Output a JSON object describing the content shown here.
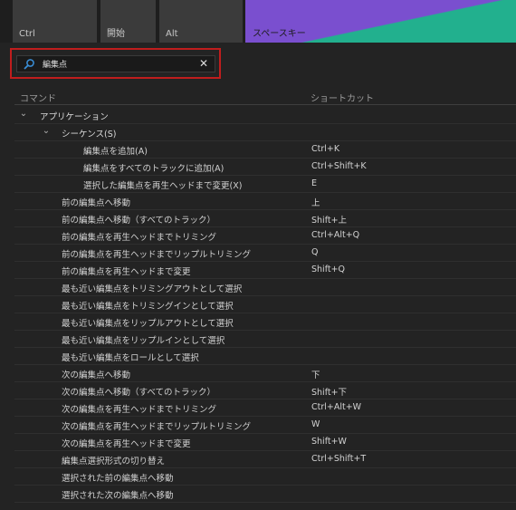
{
  "keyboard": {
    "keys": [
      {
        "label": "Ctrl"
      },
      {
        "label": "開始"
      },
      {
        "label": "Alt"
      },
      {
        "label": "スペースキー"
      }
    ]
  },
  "search": {
    "value": "編集点",
    "placeholder": ""
  },
  "columns": {
    "command": "コマンド",
    "shortcut": "ショートカット"
  },
  "tree": {
    "group": "アプリケーション",
    "subgroup": "シーケンス(S)",
    "items": [
      {
        "cmd": "編集点を追加(A)",
        "sc": "Ctrl+K"
      },
      {
        "cmd": "編集点をすべてのトラックに追加(A)",
        "sc": "Ctrl+Shift+K"
      },
      {
        "cmd": "選択した編集点を再生ヘッドまで変更(X)",
        "sc": "E"
      },
      {
        "cmd": "前の編集点へ移動",
        "sc": "上"
      },
      {
        "cmd": "前の編集点へ移動（すべてのトラック）",
        "sc": "Shift+上"
      },
      {
        "cmd": "前の編集点を再生ヘッドまでトリミング",
        "sc": "Ctrl+Alt+Q"
      },
      {
        "cmd": "前の編集点を再生ヘッドまでリップルトリミング",
        "sc": "Q"
      },
      {
        "cmd": "前の編集点を再生ヘッドまで変更",
        "sc": "Shift+Q"
      },
      {
        "cmd": "最も近い編集点をトリミングアウトとして選択",
        "sc": ""
      },
      {
        "cmd": "最も近い編集点をトリミングインとして選択",
        "sc": ""
      },
      {
        "cmd": "最も近い編集点をリップルアウトとして選択",
        "sc": ""
      },
      {
        "cmd": "最も近い編集点をリップルインとして選択",
        "sc": ""
      },
      {
        "cmd": "最も近い編集点をロールとして選択",
        "sc": ""
      },
      {
        "cmd": "次の編集点へ移動",
        "sc": "下"
      },
      {
        "cmd": "次の編集点へ移動（すべてのトラック）",
        "sc": "Shift+下"
      },
      {
        "cmd": "次の編集点を再生ヘッドまでトリミング",
        "sc": "Ctrl+Alt+W"
      },
      {
        "cmd": "次の編集点を再生ヘッドまでリップルトリミング",
        "sc": "W"
      },
      {
        "cmd": "次の編集点を再生ヘッドまで変更",
        "sc": "Shift+W"
      },
      {
        "cmd": "編集点選択形式の切り替え",
        "sc": "Ctrl+Shift+T"
      },
      {
        "cmd": "選択された前の編集点へ移動",
        "sc": ""
      },
      {
        "cmd": "選択された次の編集点へ移動",
        "sc": ""
      }
    ]
  },
  "colors": {
    "background": "#232323",
    "highlight_border": "#c01d1d",
    "space_key_purple": "#7a4fcf",
    "space_key_green": "#22b08e"
  },
  "icons": {
    "search": "magnifier-icon",
    "clear": "close-icon",
    "expand": "chevron-down-icon"
  }
}
